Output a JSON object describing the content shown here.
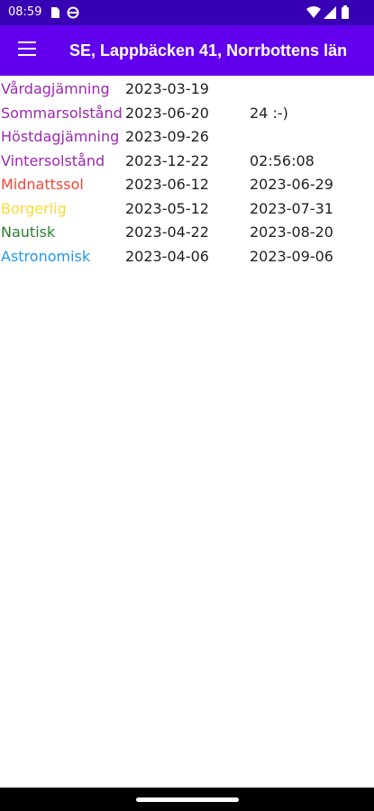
{
  "status": {
    "time": "08:59"
  },
  "appbar": {
    "title": "SE, Lappbäcken 41, Norrbottens län",
    "menu_icon": "hamburger-menu-icon"
  },
  "rows": [
    {
      "label": "Vårdagjämning",
      "color": "#9c27b0",
      "date1": "2023-03-19",
      "extra": ""
    },
    {
      "label": "Sommarsolstånd",
      "color": "#9c27b0",
      "date1": "2023-06-20",
      "extra": "24 :-)"
    },
    {
      "label": "Höstdagjämning",
      "color": "#9c27b0",
      "date1": "2023-09-26",
      "extra": ""
    },
    {
      "label": "Vintersolstånd",
      "color": "#9c27b0",
      "date1": "2023-12-22",
      "extra": "02:56:08"
    },
    {
      "label": "Midnattssol",
      "color": "#f44336",
      "date1": "2023-06-12",
      "extra": "2023-06-29"
    },
    {
      "label": "Borgerlig",
      "color": "#fdd835",
      "date1": "2023-05-12",
      "extra": "2023-07-31"
    },
    {
      "label": "Nautisk",
      "color": "#2e7d32",
      "date1": "2023-04-22",
      "extra": "2023-08-20"
    },
    {
      "label": "Astronomisk",
      "color": "#2196f3",
      "date1": "2023-04-06",
      "extra": "2023-09-06"
    }
  ]
}
